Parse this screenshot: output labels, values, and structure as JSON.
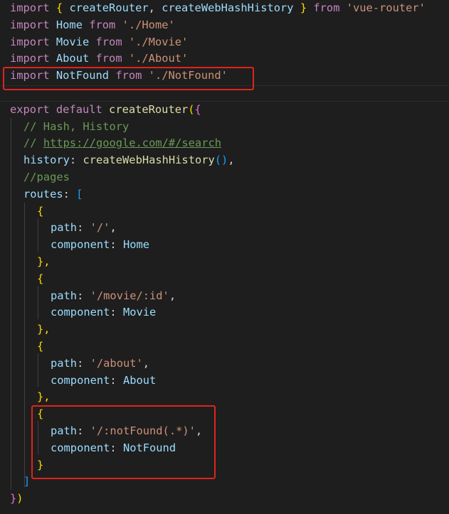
{
  "code": {
    "line1": {
      "kw": "import",
      "ob": "{",
      "name1": "createRouter",
      "comma": ",",
      "name2": "createWebHashHistory",
      "cb": "}",
      "from": "from",
      "src": "'vue-router'"
    },
    "line2": {
      "kw": "import",
      "name": "Home",
      "from": "from",
      "src": "'./Home'"
    },
    "line3": {
      "kw": "import",
      "name": "Movie",
      "from": "from",
      "src": "'./Movie'"
    },
    "line4": {
      "kw": "import",
      "name": "About",
      "from": "from",
      "src": "'./About'"
    },
    "line5": {
      "kw": "import",
      "name": "NotFound",
      "from": "from",
      "src": "'./NotFound'"
    },
    "line7": {
      "export": "export",
      "default": "default",
      "fn": "createRouter",
      "open_paren": "(",
      "open_brace": "{"
    },
    "line8": {
      "comment": "// Hash, History"
    },
    "line9": {
      "prefix": "// ",
      "url": "https://google.com/#/search"
    },
    "line10": {
      "key": "history",
      "colon": ":",
      "fn": "createWebHashHistory",
      "parens": "()",
      "comma": ","
    },
    "line11": {
      "comment": "//pages"
    },
    "line12": {
      "key": "routes",
      "colon": ":",
      "bracket": "["
    },
    "routes": [
      {
        "open": "{",
        "path_key": "path",
        "path_val": "'/'",
        "comp_key": "component",
        "comp_val": "Home",
        "close": "},"
      },
      {
        "open": "{",
        "path_key": "path",
        "path_val": "'/movie/:id'",
        "comp_key": "component",
        "comp_val": "Movie",
        "close": "},"
      },
      {
        "open": "{",
        "path_key": "path",
        "path_val": "'/about'",
        "comp_key": "component",
        "comp_val": "About",
        "close": "},"
      },
      {
        "open": "{",
        "path_key": "path",
        "path_val": "'/:notFound(.*)'",
        "comp_key": "component",
        "comp_val": "NotFound",
        "close": "}"
      }
    ],
    "close_bracket": "]",
    "close_brace": "}",
    "close_paren": ")"
  },
  "colors": {
    "background": "#1e1e1e",
    "highlight_border": "#e0241e"
  }
}
